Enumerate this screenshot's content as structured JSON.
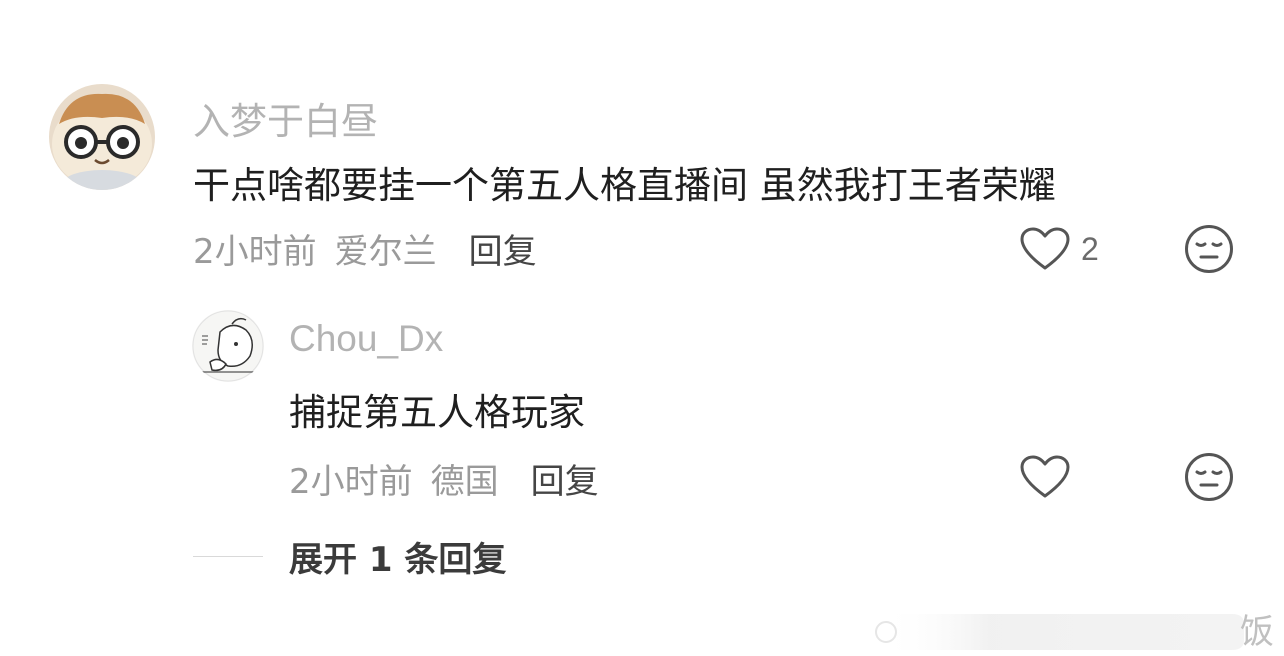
{
  "comment": {
    "username": "入梦于白昼",
    "content": "干点啥都要挂一个第五人格直播间 虽然我打王者荣耀",
    "time": "2小时前",
    "location": "爱尔兰",
    "reply_label": "回复",
    "like_count": "2",
    "avatar_icon": "plush-hamster-with-glasses",
    "reply": {
      "username": "Chou_Dx",
      "content": "捕捉第五人格玩家",
      "time": "2小时前",
      "location": "德国",
      "reply_label": "回复",
      "avatar_icon": "sketch-bird-avatar"
    },
    "expand_label": "展开 1 条回复"
  },
  "watermark": {
    "text": "饭"
  },
  "colors": {
    "username": "#b3b3b3",
    "content": "#1f1f1f",
    "meta": "#9a9a9a",
    "icon": "#555555"
  }
}
